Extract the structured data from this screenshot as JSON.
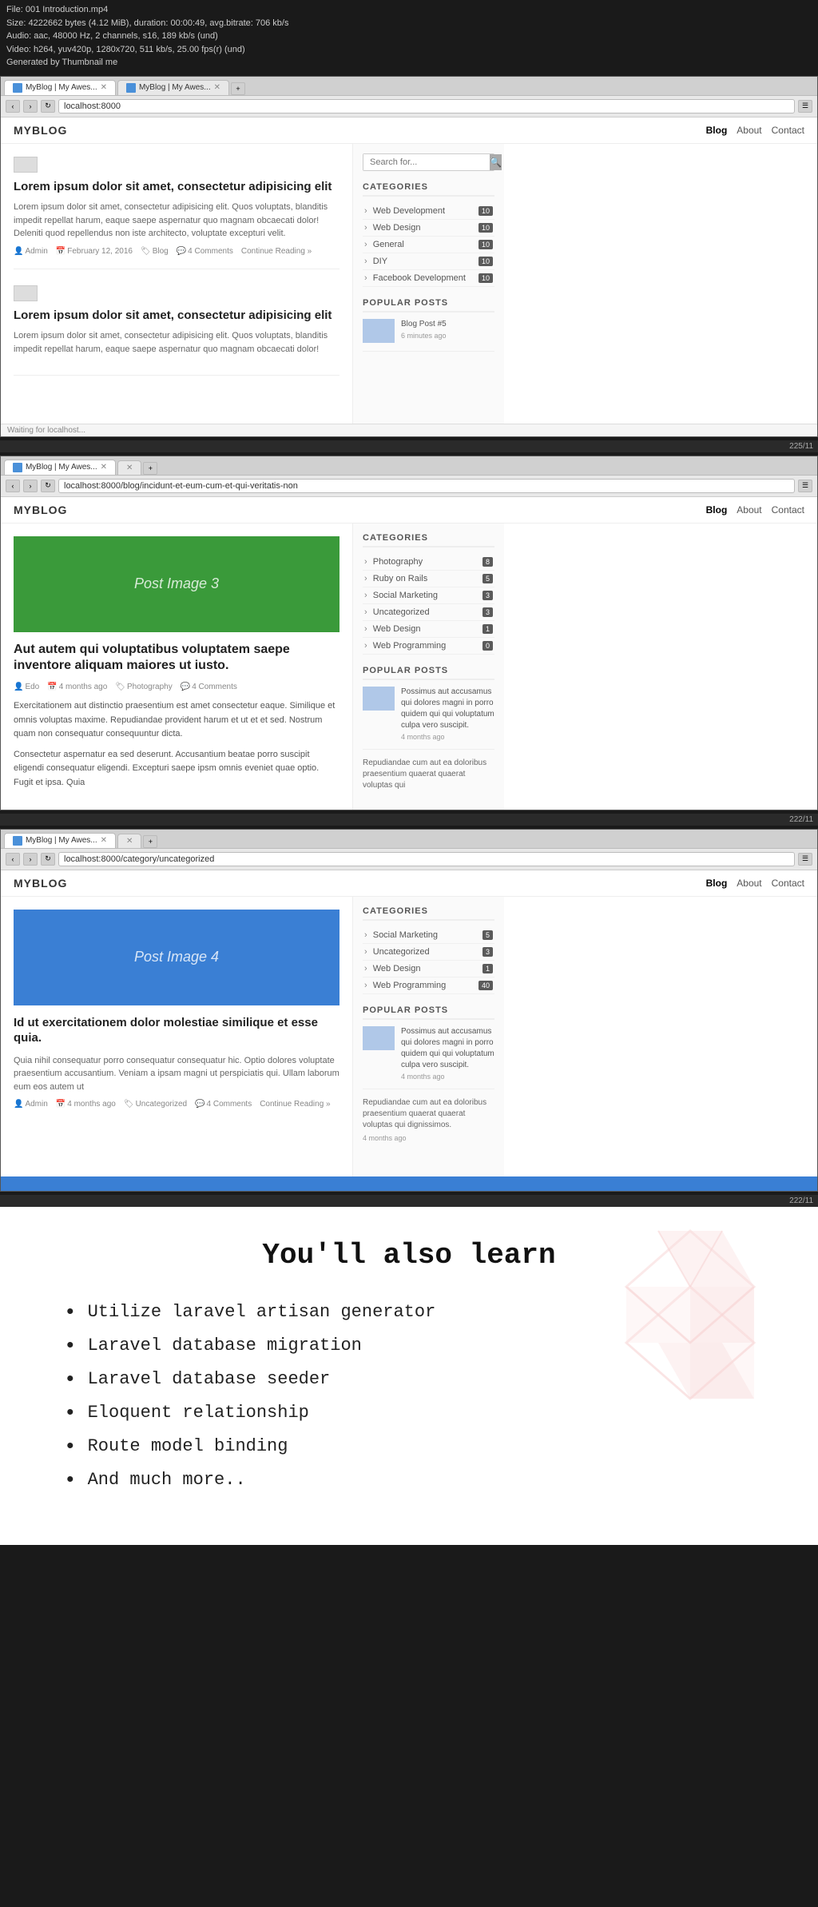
{
  "videoInfo": {
    "file": "File: 001 Introduction.mp4",
    "size": "Size: 4222662 bytes (4.12 MiB), duration: 00:00:49, avg.bitrate: 706 kb/s",
    "audio": "Audio: aac, 48000 Hz, 2 channels, s16, 189 kb/s (und)",
    "video": "Video: h264, yuv420p, 1280x720, 511 kb/s, 25.00 fps(r) (und)",
    "generated": "Generated by Thumbnail me"
  },
  "browser1": {
    "tabs": [
      {
        "label": "MyBlog | My Awes...",
        "active": true
      },
      {
        "label": "MyBlog | My Awes...",
        "active": false
      }
    ],
    "address": "localhost:8000",
    "nav": {
      "brand": "MYBLOG",
      "links": [
        "Blog",
        "About",
        "Contact"
      ],
      "activeLink": "Blog"
    },
    "sidebar": {
      "searchPlaceholder": "Search for...",
      "categoriesTitle": "CATEGORIES",
      "categories": [
        {
          "name": "Web Development",
          "count": 10
        },
        {
          "name": "Web Design",
          "count": 10
        },
        {
          "name": "General",
          "count": 10
        },
        {
          "name": "DIY",
          "count": 10
        },
        {
          "name": "Facebook Development",
          "count": 10
        }
      ],
      "popularPostsTitle": "POPULAR POSTS",
      "popularPosts": [
        {
          "title": "Blog Post #5",
          "date": "6 minutes ago"
        }
      ]
    },
    "posts": [
      {
        "title": "Lorem ipsum dolor sit amet, consectetur adipisicing elit",
        "excerpt": "Lorem ipsum dolor sit amet, consectetur adipisicing elit. Quos voluptats, blanditis impedit repellat harum, eaque saepe aspernatur quo magnam obcaecati dolor! Deleniti quod repellendus non iste architecto, voluptate excepturi velit.",
        "author": "Admin",
        "date": "February 12, 2016",
        "category": "Blog",
        "comments": "4 Comments",
        "continueLink": "Continue Reading »"
      },
      {
        "title": "Lorem ipsum dolor sit amet, consectetur adipisicing elit",
        "excerpt": "Lorem ipsum dolor sit amet, consectetur adipisicing elit. Quos voluptats, blanditis impedit repellat harum, eaque saepe aspernatur quo magnam obcaecati dolor!",
        "author": "",
        "date": "",
        "category": "",
        "comments": "",
        "continueLink": ""
      }
    ],
    "statusBar": "Waiting for localhost..."
  },
  "timestamp1": "225/11",
  "browser2": {
    "tabs": [
      {
        "label": "MyBlog | My Awes...",
        "active": true
      },
      {
        "label": "",
        "active": false
      }
    ],
    "address": "localhost:8000/blog/incidunt-et-eum-cum-et-qui-veritatis-non",
    "nav": {
      "brand": "MYBLOG",
      "links": [
        "Blog",
        "About",
        "Contact"
      ],
      "activeLink": "Blog"
    },
    "postFeaturedImage": "Post Image 3",
    "postFeaturedColor": "green",
    "postTitle": "Aut autem qui voluptatibus voluptatem saepe inventore aliquam maiores ut iusto.",
    "postMeta": {
      "author": "Edo",
      "date": "4 months ago",
      "category": "Photography",
      "comments": "4 Comments"
    },
    "postBody1": "Exercitationem aut distinctio praesentium est amet consectetur eaque. Similique et omnis voluptas maxime. Repudiandae provident harum et ut et et sed. Nostrum quam non consequatur consequuntur dicta.",
    "postBody2": "Consectetur aspernatur ea sed deserunt. Accusantium beatae porro suscipit eligendi consequatur eligendi. Excepturi saepe ipsm omnis eveniet quae optio. Fugit et ipsa. Quia",
    "sidebar": {
      "categoriesTitle": "CATEGORIES",
      "categories": [
        {
          "name": "Photography",
          "count": 8
        },
        {
          "name": "Ruby on Rails",
          "count": 5
        },
        {
          "name": "Social Marketing",
          "count": 3
        },
        {
          "name": "Uncategorized",
          "count": 3
        },
        {
          "name": "Web Design",
          "count": 1
        },
        {
          "name": "Web Programming",
          "count": 0
        }
      ],
      "popularPostsTitle": "POPULAR POSTS",
      "popularPosts": [
        {
          "title": "Possimus aut accusamus qui dolores magni in porro quidem qui qui voluptatum culpa vero suscipit.",
          "date": "4 months ago"
        }
      ],
      "popularPostExcerpt": "Repudiandae cum aut ea doloribus praesentium quaerat quaerat voluptas qui"
    }
  },
  "timestamp2": "222/11",
  "browser3": {
    "tabs": [
      {
        "label": "MyBlog | My Awes...",
        "active": true
      },
      {
        "label": "",
        "active": false
      }
    ],
    "address": "localhost:8000/category/uncategorized",
    "nav": {
      "brand": "MYBLOG",
      "links": [
        "Blog",
        "About",
        "Contact"
      ],
      "activeLink": "Blog"
    },
    "postFeaturedImage": "Post Image 4",
    "postFeaturedColor": "blue",
    "postTitle": "Id ut exercitationem dolor molestiae similique et esse quia.",
    "postMeta": {
      "author": "Admin",
      "date": "4 months ago",
      "category": "Uncategorized",
      "comments": "4 Comments"
    },
    "postExcerpt": "Quia nihil consequatur porro consequatur consequatur hic. Optio dolores voluptate praesentium accusantium. Veniam a ipsam magni ut perspiciatis qui. Ullam laborum eum eos autem ut",
    "continueLink": "Continue Reading »",
    "sidebar": {
      "categoriesTitle": "CATEGORIES",
      "categories": [
        {
          "name": "Social Marketing",
          "count": 5
        },
        {
          "name": "Uncategorized",
          "count": 3
        },
        {
          "name": "Web Design",
          "count": 1
        },
        {
          "name": "Web Programming",
          "count": 40
        }
      ],
      "popularPostsTitle": "POPULAR POSTS",
      "popularPosts": [
        {
          "title": "Possimus aut accusamus qui dolores magni in porro quidem qui qui voluptatum culpa vero suscipit.",
          "date": "4 months ago"
        }
      ],
      "popularPostExcerpt": "Repudiandae cum aut ea doloribus praesentium quaerat quaerat voluptas qui dignissimos.",
      "popularPostDate2": "4 months ago"
    }
  },
  "timestamp3": "222/11",
  "learnSection": {
    "title": "You'll also learn",
    "items": [
      "Utilize laravel artisan generator",
      "Laravel database migration",
      "Laravel database seeder",
      "Eloquent relationship",
      "Route model binding",
      "And much more.."
    ]
  },
  "icons": {
    "search": "🔍",
    "user": "👤",
    "calendar": "📅",
    "folder": "📁",
    "comment": "💬",
    "chevron": "›"
  }
}
